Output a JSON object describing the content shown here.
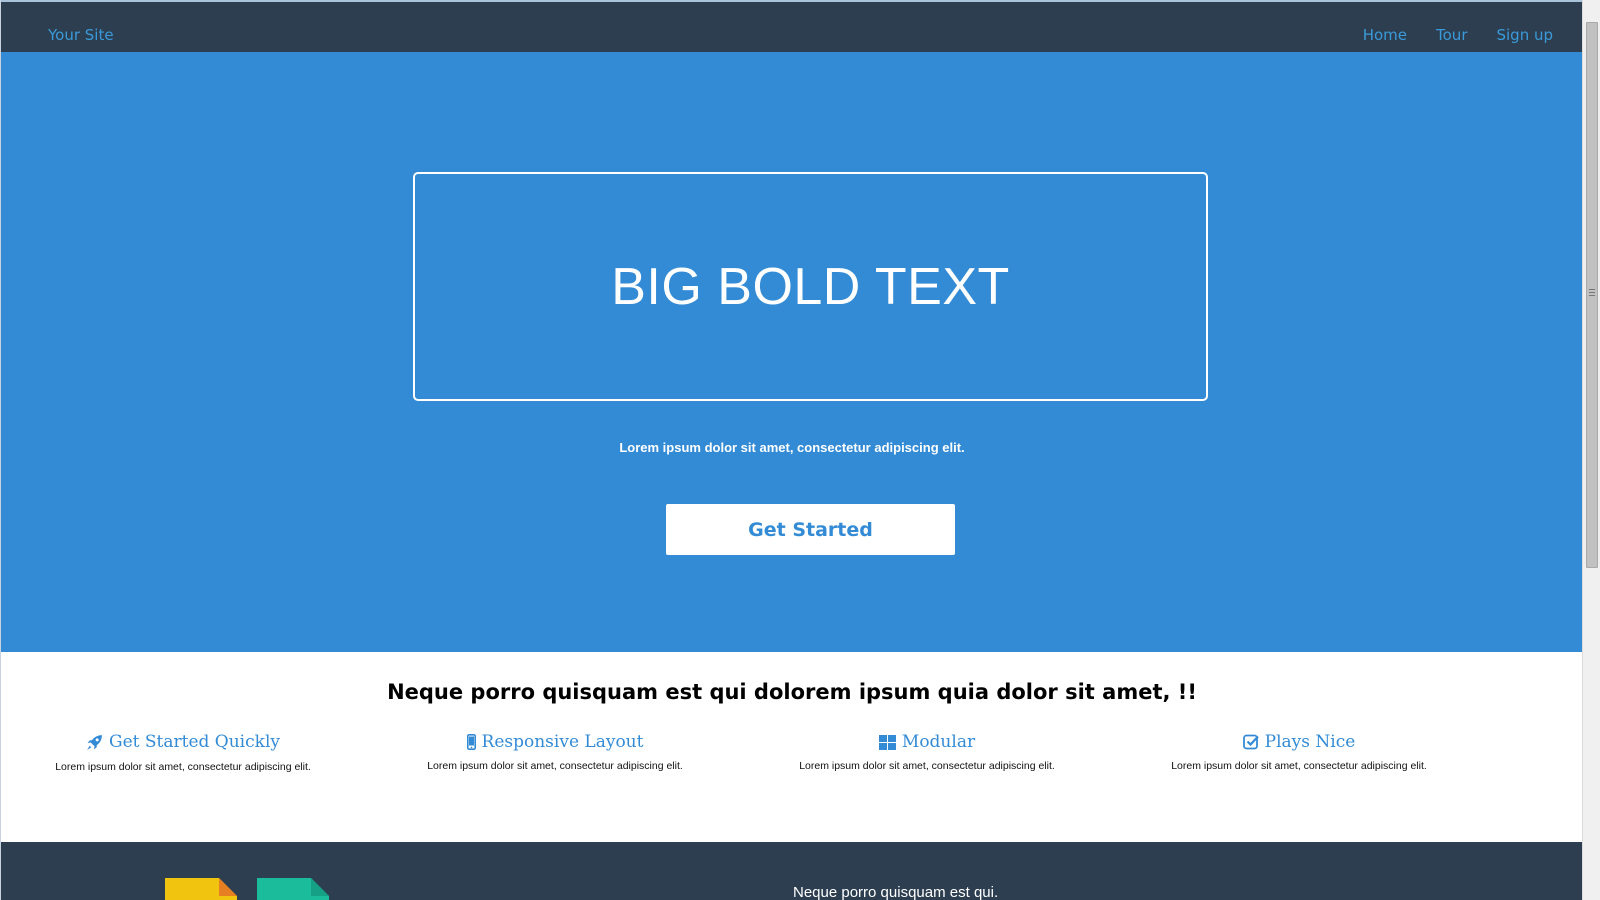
{
  "navbar": {
    "brand": "Your Site",
    "links": [
      {
        "label": "Home"
      },
      {
        "label": "Tour"
      },
      {
        "label": "Sign up"
      }
    ]
  },
  "hero": {
    "title": "BIG BOLD TEXT",
    "subtitle": "Lorem ipsum dolor sit amet, consectetur adipiscing elit.",
    "cta_label": "Get Started"
  },
  "features": {
    "heading": "Neque porro quisquam est qui dolorem ipsum quia dolor sit amet, !!",
    "items": [
      {
        "icon": "rocket-icon",
        "title": "Get Started Quickly",
        "text": "Lorem ipsum dolor sit amet, consectetur adipiscing elit."
      },
      {
        "icon": "mobile-icon",
        "title": "Responsive Layout",
        "text": "Lorem ipsum dolor sit amet, consectetur adipiscing elit."
      },
      {
        "icon": "grid-icon",
        "title": "Modular",
        "text": "Lorem ipsum dolor sit amet, consectetur adipiscing elit."
      },
      {
        "icon": "checkbox-icon",
        "title": "Plays Nice",
        "text": "Lorem ipsum dolor sit amet, consectetur adipiscing elit."
      }
    ]
  },
  "band": {
    "text": "Neque porro quisquam est qui."
  },
  "colors": {
    "navbar_bg": "#2c3e50",
    "link": "#3a9ad9",
    "hero_bg": "#338bd6",
    "doc_yellow": "#f1c40f",
    "doc_green": "#1abc9c"
  }
}
